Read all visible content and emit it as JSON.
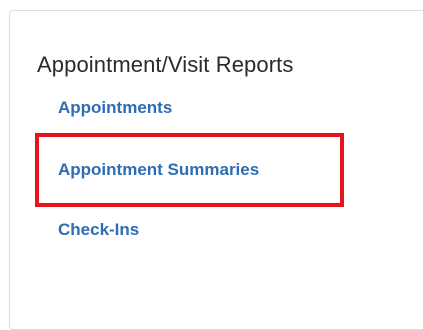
{
  "panel": {
    "title": "Appointment/Visit Reports",
    "links": [
      {
        "label": "Appointments"
      },
      {
        "label": "Appointment Summaries"
      },
      {
        "label": "Check-Ins"
      }
    ]
  },
  "colors": {
    "link": "#2e6db4",
    "title": "#2b2b2b",
    "highlight": "#e8141c",
    "panel_border": "#dcdcdc"
  },
  "highlight": {
    "target": "Appointment Summaries"
  }
}
